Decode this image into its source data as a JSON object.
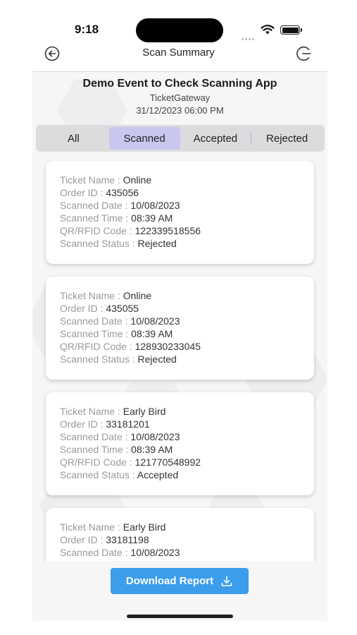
{
  "status_bar": {
    "time": "9:18"
  },
  "nav": {
    "title": "Scan Summary",
    "back_icon": "back-arrow-icon",
    "logout_icon": "logout-icon"
  },
  "event": {
    "name": "Demo Event to Check Scanning App",
    "organizer": "TicketGateway",
    "datetime": "31/12/2023 06:00 PM"
  },
  "tabs": [
    {
      "label": "All",
      "active": false
    },
    {
      "label": "Scanned",
      "active": true
    },
    {
      "label": "Accepted",
      "active": false
    },
    {
      "label": "Rejected",
      "active": false
    }
  ],
  "field_labels": {
    "ticket_name": "Ticket Name",
    "order_id": "Order ID",
    "scanned_date": "Scanned Date",
    "scanned_time": "Scanned Time",
    "code": "QR/RFID Code",
    "status": "Scanned Status"
  },
  "tickets": [
    {
      "ticket_name": "Online",
      "order_id": "435056",
      "scanned_date": "10/08/2023",
      "scanned_time": "08:39 AM",
      "code": "122339518556",
      "status": "Rejected"
    },
    {
      "ticket_name": "Online",
      "order_id": "435055",
      "scanned_date": "10/08/2023",
      "scanned_time": "08:39 AM",
      "code": "128930233045",
      "status": "Rejected"
    },
    {
      "ticket_name": "Early Bird",
      "order_id": "33181201",
      "scanned_date": "10/08/2023",
      "scanned_time": "08:39 AM",
      "code": "121770548992",
      "status": "Accepted"
    },
    {
      "ticket_name": "Early Bird",
      "order_id": "33181198",
      "scanned_date": "10/08/2023"
    }
  ],
  "download_button": {
    "label": "Download Report",
    "icon": "download-icon"
  },
  "colors": {
    "accent": "#3b9eec",
    "active_tab": "#c9c6ef"
  }
}
